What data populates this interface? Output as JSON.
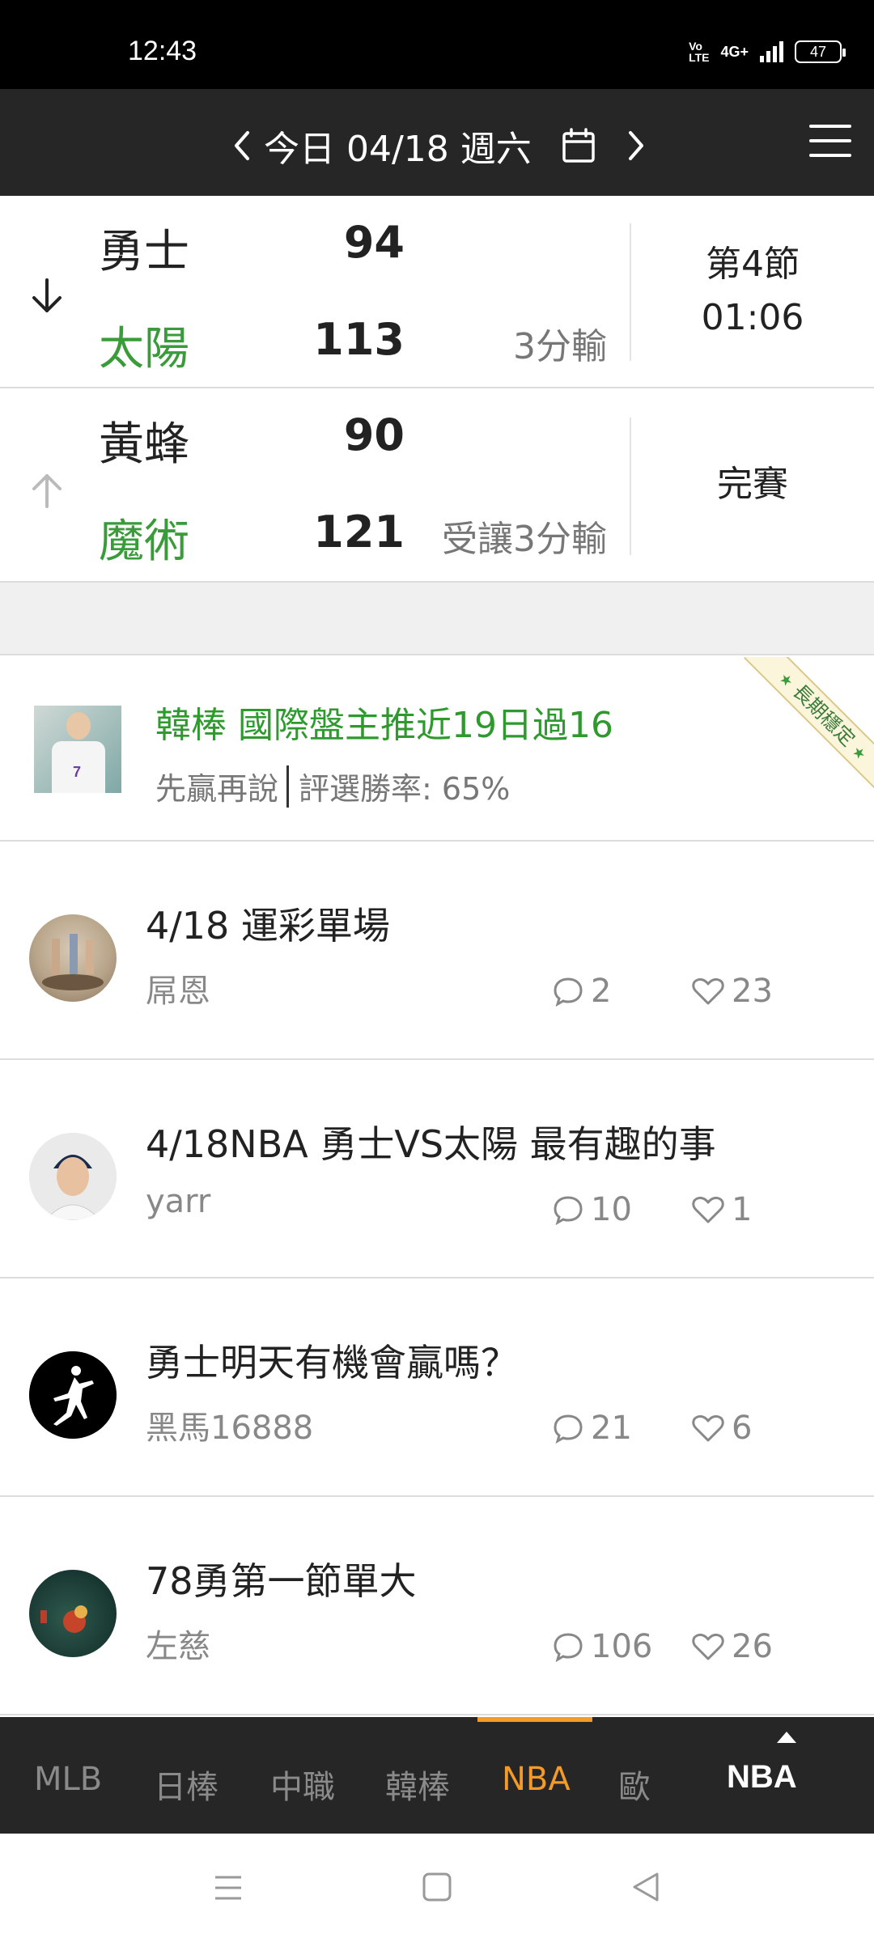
{
  "status_bar": {
    "time": "12:43",
    "volte": "Vo LTE",
    "network": "4G+",
    "battery": "47"
  },
  "top_nav": {
    "date_label": "今日 04/18 週六",
    "icons": [
      "chevron-left-icon",
      "calendar-icon",
      "chevron-right-icon",
      "menu-icon"
    ]
  },
  "games": [
    {
      "away_team": "勇士",
      "away_score": "94",
      "home_team": "太陽",
      "home_score": "113",
      "result": "3分輸",
      "status_line1": "第4節",
      "status_line2": "01:06",
      "arrow": "down"
    },
    {
      "away_team": "黃蜂",
      "away_score": "90",
      "home_team": "魔術",
      "home_score": "121",
      "result": "受讓3分輸",
      "status_line1": "完賽",
      "status_line2": "",
      "arrow": "up"
    }
  ],
  "promo": {
    "title": "韓棒 國際盤主推近19日過16",
    "author": "先贏再說",
    "win_rate": "評選勝率: 65%",
    "ribbon": "長期穩定"
  },
  "posts": [
    {
      "title": "4/18 運彩單場",
      "author": "屌恩",
      "comments": "2",
      "likes": "23"
    },
    {
      "title": "4/18NBA 勇士VS太陽 最有趣的事",
      "author": "yarr",
      "comments": "10",
      "likes": "1"
    },
    {
      "title": "勇士明天有機會贏嗎？",
      "author": "黑馬16888",
      "comments": "21",
      "likes": "6"
    },
    {
      "title": "78勇第一節單大",
      "author": "左慈",
      "comments": "106",
      "likes": "26"
    }
  ],
  "league_tabs": [
    "MLB",
    "日棒",
    "中職",
    "韓棒",
    "NBA",
    "歐"
  ],
  "active_tab": "NBA",
  "fixed_tab": "NBA",
  "colors": {
    "accent": "#f39a28",
    "winner_green": "#3a9b3a",
    "nav_bg": "#262626"
  }
}
